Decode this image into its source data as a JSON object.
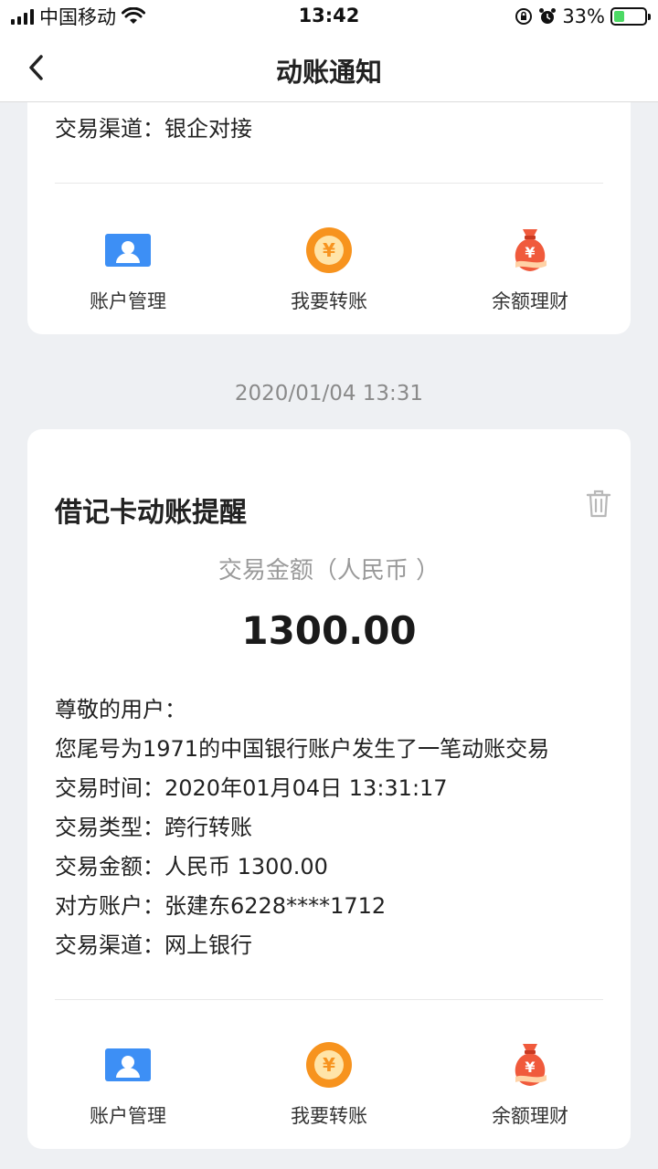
{
  "status": {
    "carrier": "中国移动",
    "time": "13:42",
    "battery": "33%",
    "battery_level": 0.33
  },
  "nav": {
    "title": "动账通知"
  },
  "prev_card": {
    "channel": "交易渠道：银企对接"
  },
  "actions": [
    {
      "label": "账户管理",
      "icon": "account-card-icon"
    },
    {
      "label": "我要转账",
      "icon": "yuan-coin-icon"
    },
    {
      "label": "余额理财",
      "icon": "money-bag-icon"
    }
  ],
  "date_separator": "2020/01/04 13:31",
  "card": {
    "title": "借记卡动账提醒",
    "amount_label": "交易金额（人民币 ）",
    "amount": "1300.00",
    "lines": [
      "尊敬的用户：",
      "您尾号为1971的中国银行账户发生了一笔动账交易",
      "交易时间：2020年01月04日 13:31:17",
      "交易类型：跨行转账",
      "交易金额：人民币 1300.00",
      "对方账户：张建东6228****1712",
      "交易渠道：网上银行"
    ]
  },
  "colors": {
    "accent_blue": "#3d8ff5",
    "coin_orange": "#f7931e",
    "bag_red": "#f05a3c"
  }
}
